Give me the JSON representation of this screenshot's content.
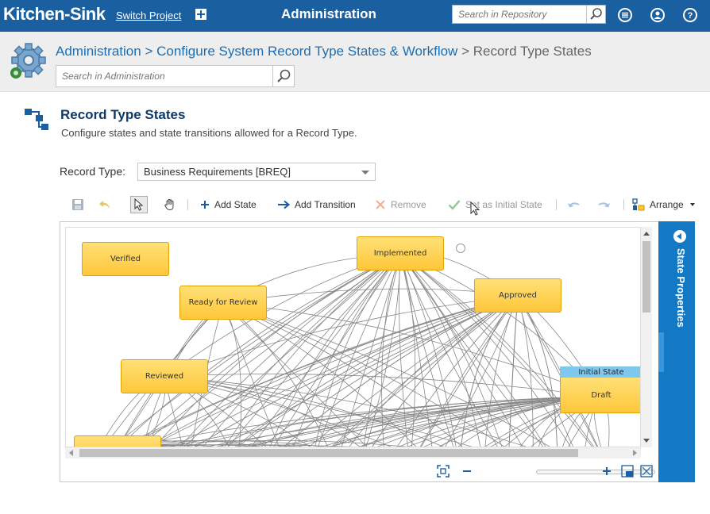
{
  "topbar": {
    "project_name": "Kitchen-Sink",
    "switch_project": "Switch Project",
    "app_title": "Administration",
    "search_placeholder": "Search in Repository"
  },
  "breadcrumb": {
    "root": "Administration",
    "sep1": ">",
    "middle": "Configure System Record Type States & Workflow",
    "sep2": ">",
    "current": "Record Type States"
  },
  "admin_search": {
    "placeholder": "Search in Administration"
  },
  "section": {
    "title": "Record Type States",
    "description": "Configure states and state transitions allowed for a Record Type."
  },
  "record_type": {
    "label": "Record Type:",
    "selected": "Business Requirements [BREQ]"
  },
  "toolbar": {
    "add_state": "Add State",
    "add_transition": "Add Transition",
    "remove": "Remove",
    "set_initial": "Set as Initial State",
    "arrange": "Arrange"
  },
  "diagram": {
    "states": [
      {
        "name": "Verified"
      },
      {
        "name": "Implemented"
      },
      {
        "name": "Ready for Review"
      },
      {
        "name": "Approved"
      },
      {
        "name": "Reviewed"
      },
      {
        "name": "Draft"
      }
    ],
    "initial_state_tag": "Initial State",
    "initial_state": "Draft"
  },
  "side_panel": {
    "label": "State Properties"
  },
  "colors": {
    "brand_blue": "#1a5fa0",
    "panel_blue": "#1379c5",
    "state_fill": "#ffc73a",
    "initial_tag": "#7ec8f0"
  }
}
